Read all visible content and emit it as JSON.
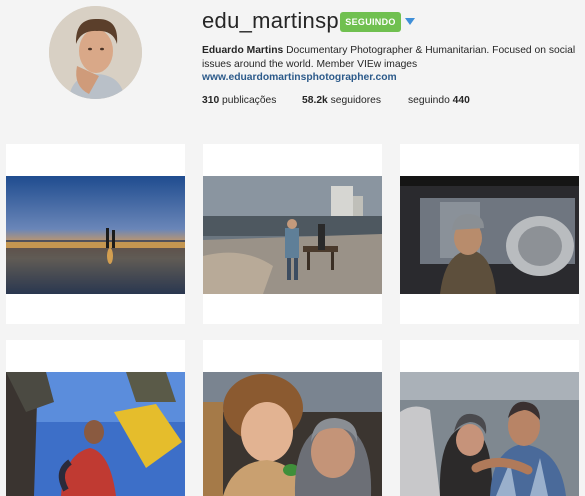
{
  "profile": {
    "username": "edu_martinsp",
    "follow_button": "SEGUINDO",
    "full_name": "Eduardo Martins",
    "bio_line1": " Documentary Photographer & Humanitarian. Focused on social issues around the world. Member VIEw images",
    "website": "www.eduardomartinsphotographer.com"
  },
  "stats": {
    "posts_count": "310",
    "posts_label": " publicações",
    "followers_count": "58.2k",
    "followers_label": " seguidores",
    "following_label": "seguindo ",
    "following_count": "440"
  },
  "posts": [
    {
      "subject": "sunset-beach"
    },
    {
      "subject": "gaza-beach-boy"
    },
    {
      "subject": "man-by-window"
    },
    {
      "subject": "water-container"
    },
    {
      "subject": "child-and-woman"
    },
    {
      "subject": "men-embracing"
    }
  ],
  "colors": {
    "follow_button": "#70c050",
    "link": "#2c5a8a",
    "caret": "#3f8fd8"
  }
}
